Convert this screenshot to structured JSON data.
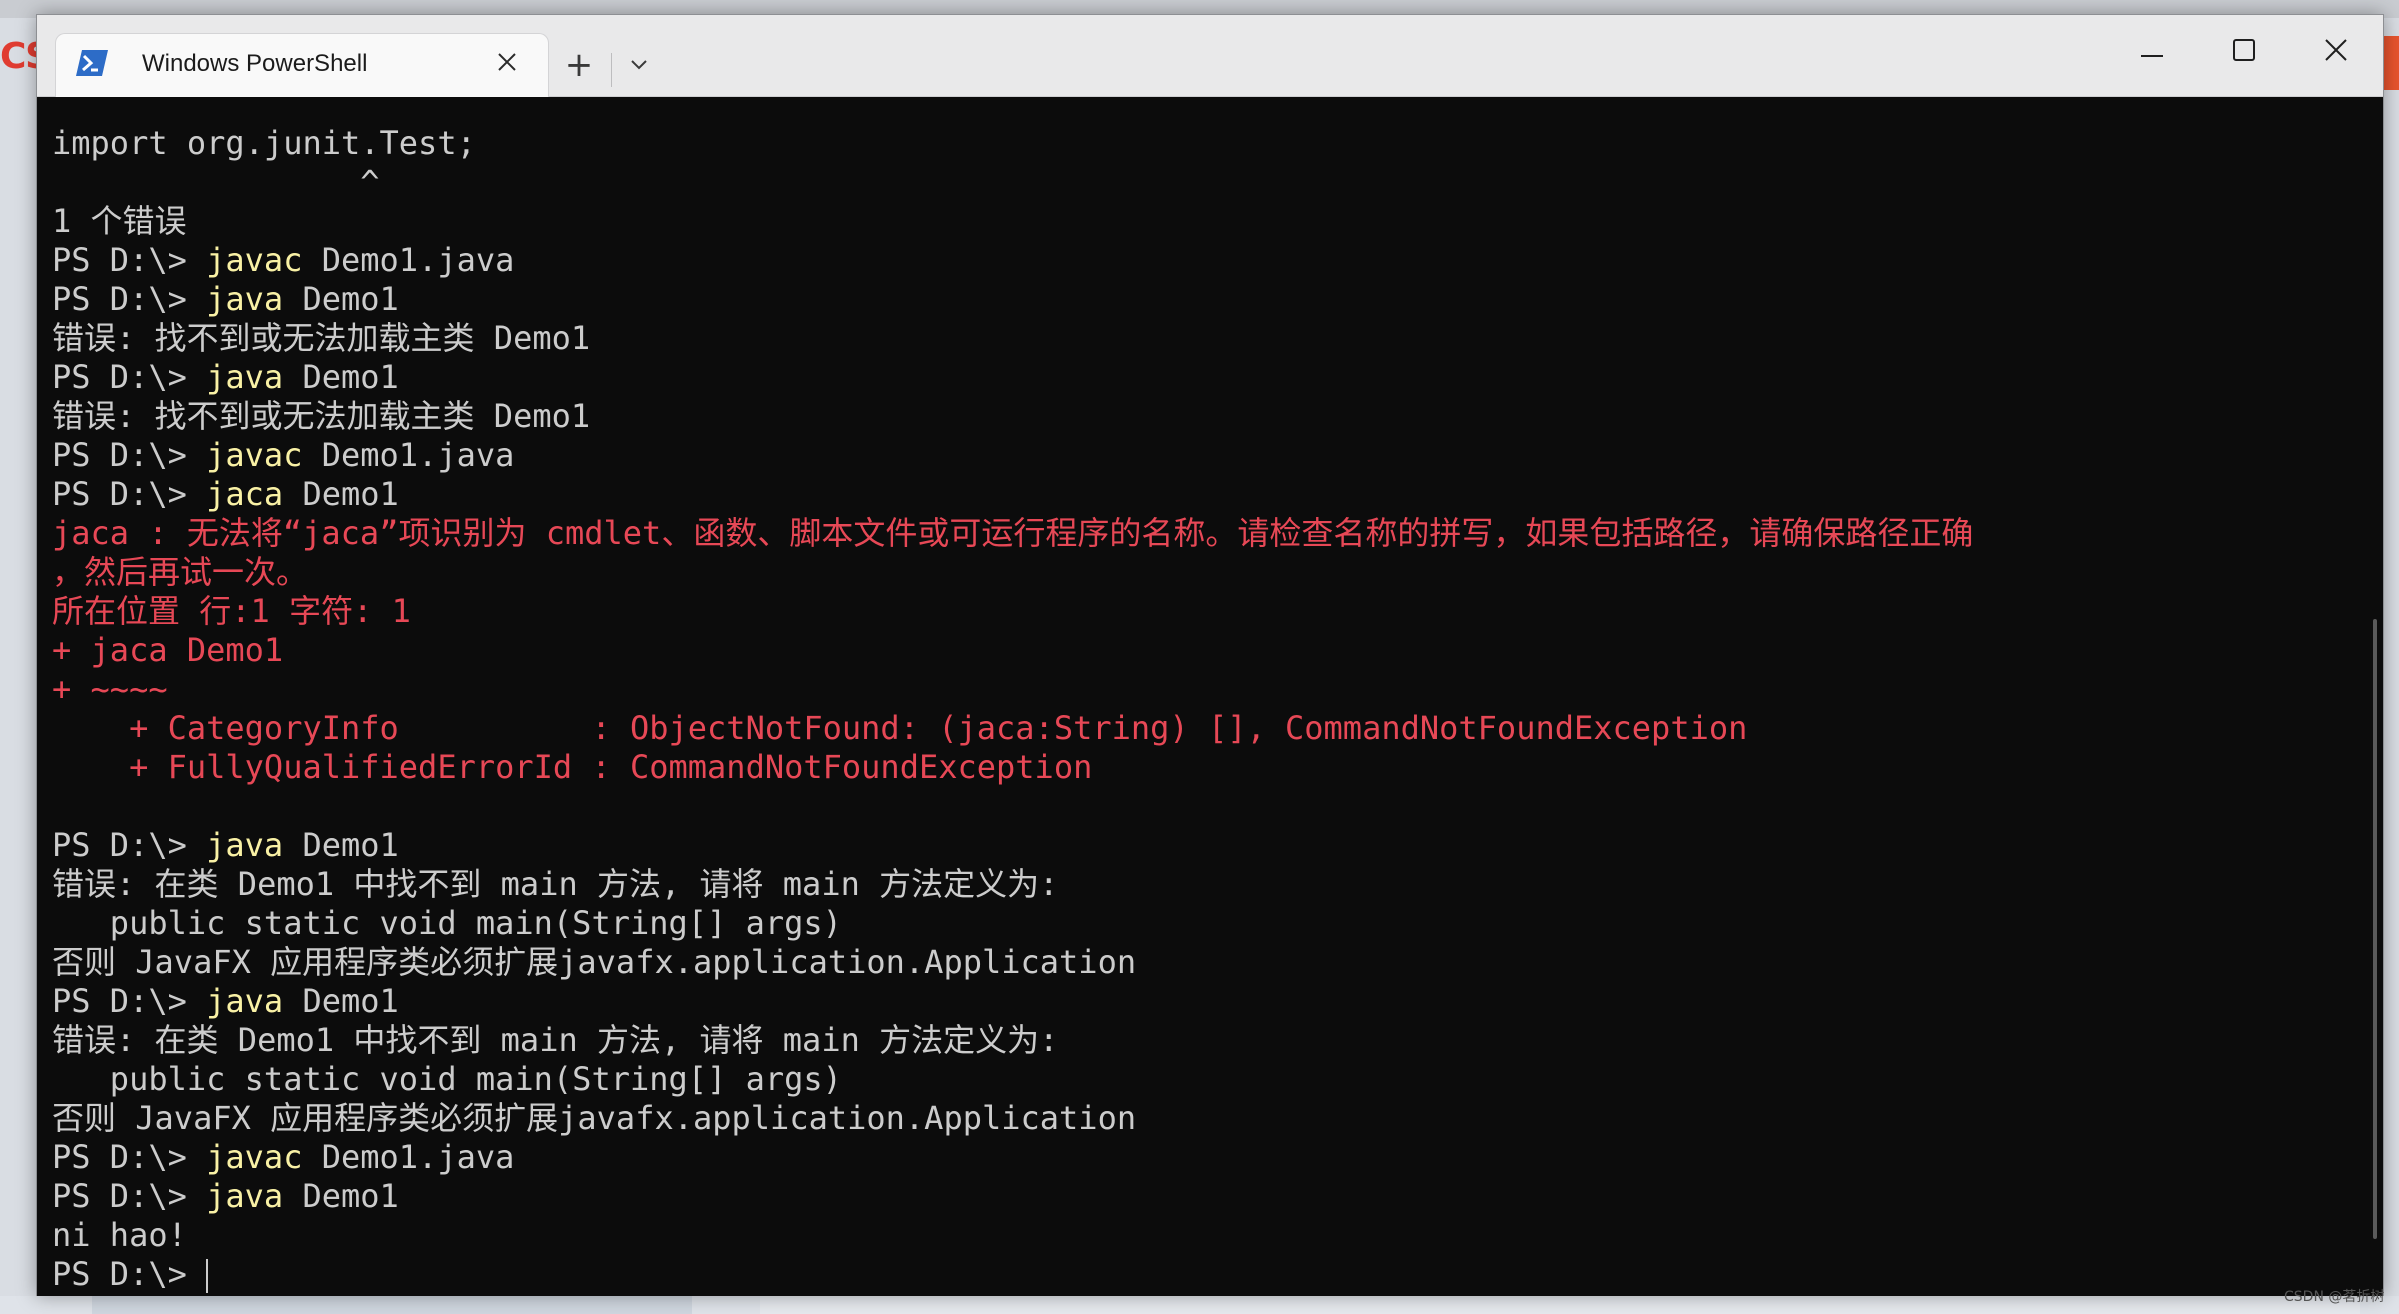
{
  "window": {
    "tab_title": "Windows PowerShell",
    "new_tab_label": "+",
    "icons": {
      "tab_icon": "powershell-icon",
      "tab_close": "close-icon",
      "new_tab": "plus-icon",
      "dropdown": "chevron-down-icon",
      "minimize": "minimize-icon",
      "maximize": "maximize-icon",
      "close": "close-icon"
    }
  },
  "colors": {
    "terminal_bg": "#0c0c0c",
    "text": "#cccccc",
    "command": "#f9f1a5",
    "error": "#e74856"
  },
  "terminal": {
    "lines": [
      {
        "text": "import org.junit.Test;",
        "style": "normal"
      },
      {
        "text": "                ^",
        "style": "normal"
      },
      {
        "text": "1 个错误",
        "style": "normal"
      },
      {
        "prompt": "PS D:\\> ",
        "cmd": "javac",
        "args": " Demo1.java",
        "style": "prompt"
      },
      {
        "prompt": "PS D:\\> ",
        "cmd": "java",
        "args": " Demo1",
        "style": "prompt"
      },
      {
        "text": "错误: 找不到或无法加载主类 Demo1",
        "style": "normal"
      },
      {
        "prompt": "PS D:\\> ",
        "cmd": "java",
        "args": " Demo1",
        "style": "prompt"
      },
      {
        "text": "错误: 找不到或无法加载主类 Demo1",
        "style": "normal"
      },
      {
        "prompt": "PS D:\\> ",
        "cmd": "javac",
        "args": " Demo1.java",
        "style": "prompt"
      },
      {
        "prompt": "PS D:\\> ",
        "cmd": "jaca",
        "args": " Demo1",
        "style": "prompt"
      },
      {
        "text": "jaca : 无法将“jaca”项识别为 cmdlet、函数、脚本文件或可运行程序的名称。请检查名称的拼写，如果包括路径，请确保路径正确",
        "style": "red"
      },
      {
        "text": "，然后再试一次。",
        "style": "red"
      },
      {
        "text": "所在位置 行:1 字符: 1",
        "style": "red"
      },
      {
        "text": "+ jaca Demo1",
        "style": "red"
      },
      {
        "text": "+ ~~~~",
        "style": "red"
      },
      {
        "text": "    + CategoryInfo          : ObjectNotFound: (jaca:String) [], CommandNotFoundException",
        "style": "red"
      },
      {
        "text": "    + FullyQualifiedErrorId : CommandNotFoundException",
        "style": "red"
      },
      {
        "text": "",
        "style": "normal"
      },
      {
        "prompt": "PS D:\\> ",
        "cmd": "java",
        "args": " Demo1",
        "style": "prompt"
      },
      {
        "text": "错误: 在类 Demo1 中找不到 main 方法, 请将 main 方法定义为:",
        "style": "normal"
      },
      {
        "text": "   public static void main(String[] args)",
        "style": "normal"
      },
      {
        "text": "否则 JavaFX 应用程序类必须扩展javafx.application.Application",
        "style": "normal"
      },
      {
        "prompt": "PS D:\\> ",
        "cmd": "java",
        "args": " Demo1",
        "style": "prompt"
      },
      {
        "text": "错误: 在类 Demo1 中找不到 main 方法, 请将 main 方法定义为:",
        "style": "normal"
      },
      {
        "text": "   public static void main(String[] args)",
        "style": "normal"
      },
      {
        "text": "否则 JavaFX 应用程序类必须扩展javafx.application.Application",
        "style": "normal"
      },
      {
        "prompt": "PS D:\\> ",
        "cmd": "javac",
        "args": " Demo1.java",
        "style": "prompt"
      },
      {
        "prompt": "PS D:\\> ",
        "cmd": "java",
        "args": " Demo1",
        "style": "prompt"
      },
      {
        "text": "ni hao!",
        "style": "normal"
      },
      {
        "prompt": "PS D:\\> ",
        "cmd": "",
        "args": "",
        "style": "prompt",
        "cursor": true
      }
    ]
  },
  "background": {
    "left_logo_text": "CS",
    "watermark": "CSDN @茗折树"
  }
}
